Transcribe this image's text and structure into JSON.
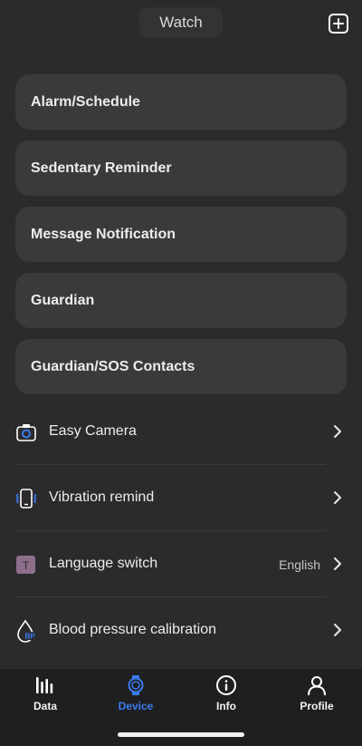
{
  "header": {
    "title": "Watch"
  },
  "cards": [
    {
      "label": "Alarm/Schedule"
    },
    {
      "label": "Sedentary Reminder"
    },
    {
      "label": "Message Notification"
    },
    {
      "label": "Guardian"
    },
    {
      "label": "Guardian/SOS Contacts"
    }
  ],
  "list": [
    {
      "label": "Easy Camera",
      "icon": "camera-icon"
    },
    {
      "label": "Vibration remind",
      "icon": "vibration-icon"
    },
    {
      "label": "Language switch",
      "value": "English",
      "icon": "language-icon",
      "icon_letter": "T"
    },
    {
      "label": "Blood pressure calibration",
      "icon": "blood-pressure-icon",
      "icon_text": "BP"
    }
  ],
  "tabs": [
    {
      "label": "Data",
      "icon": "data-bars-icon"
    },
    {
      "label": "Device",
      "icon": "watch-icon",
      "active": true
    },
    {
      "label": "Info",
      "icon": "info-icon"
    },
    {
      "label": "Profile",
      "icon": "profile-icon"
    }
  ],
  "colors": {
    "accent": "#3a7bf0",
    "background": "#2b2b2d",
    "card": "#3a3a3c",
    "tabbar": "#1f1f21"
  }
}
